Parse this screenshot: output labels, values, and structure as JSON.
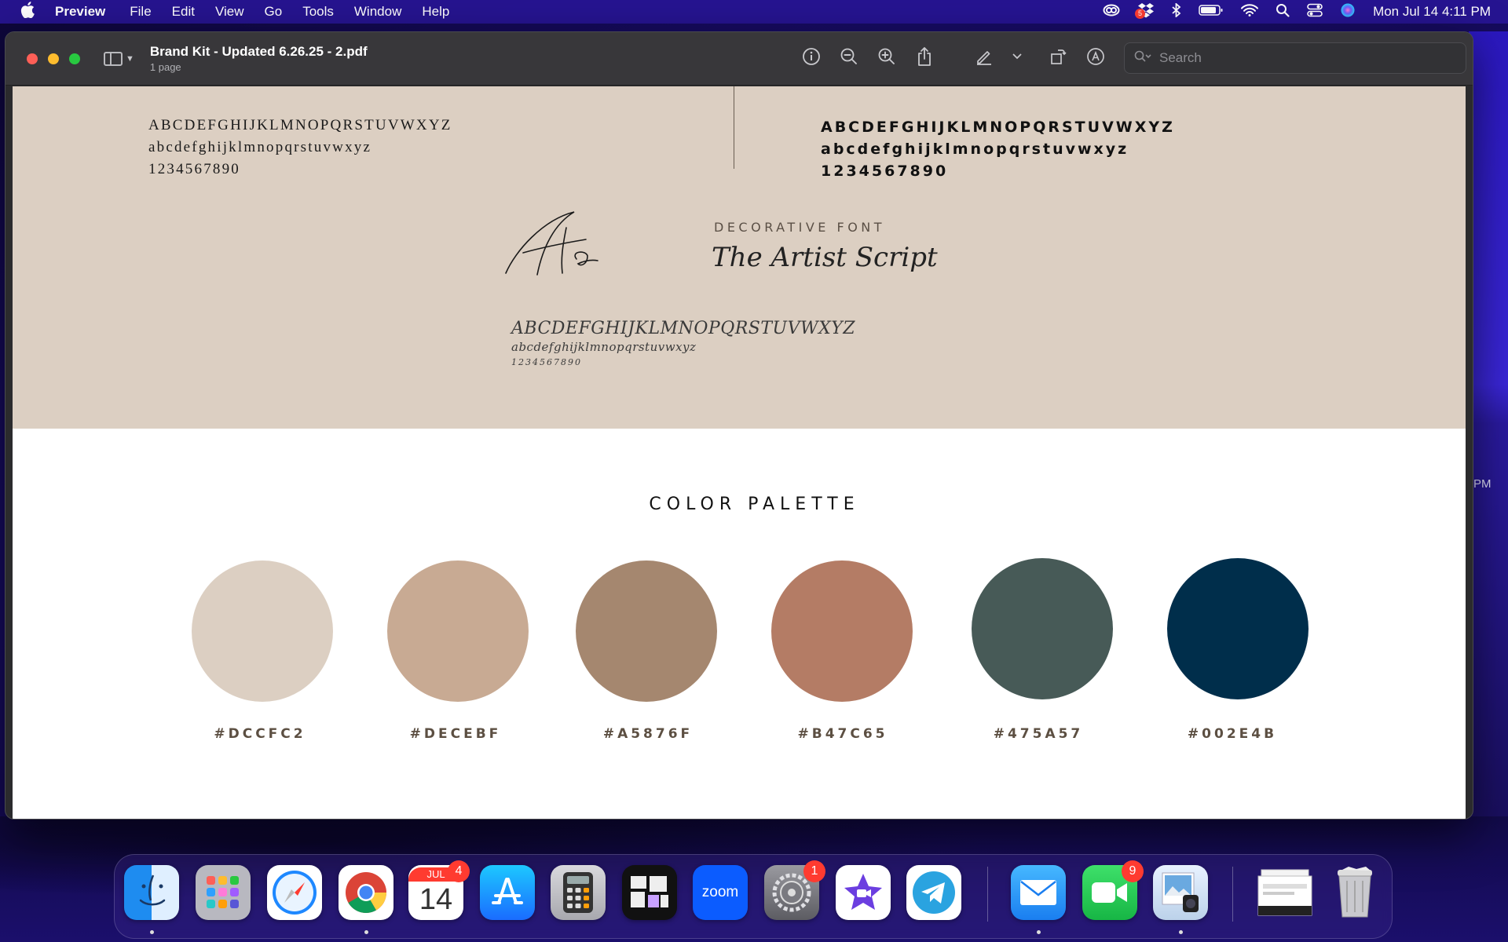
{
  "menubar": {
    "app_name": "Preview",
    "items": [
      "File",
      "Edit",
      "View",
      "Go",
      "Tools",
      "Window",
      "Help"
    ],
    "clock": "Mon Jul 14  4:11 PM",
    "status_icons": [
      "creative-cloud-icon",
      "dropbox-icon",
      "bluetooth-icon",
      "battery-icon",
      "wifi-icon",
      "spotlight-icon",
      "control-center-icon",
      "siri-icon"
    ],
    "dropbox_badge": "5"
  },
  "window": {
    "title": "Brand Kit - Updated 6.26.25 - 2.pdf",
    "subtitle": "1 page",
    "search_placeholder": "Search"
  },
  "document": {
    "serif_alphabet": {
      "upper": "ABCDEFGHIJKLMNOPQRSTUVWXYZ",
      "lower": "abcdefghijklmnopqrstuvwxyz",
      "digits": "1234567890"
    },
    "sans_alphabet": {
      "upper": "ABCDEFGHIJKLMNOPQRSTUVWXYZ",
      "lower": "abcdefghijklmnopqrstuvwxyz",
      "digits": "1234567890"
    },
    "script_glyph": "Aa",
    "decorative_label": "DECORATIVE FONT",
    "decorative_name": "The Artist Script",
    "script_alphabet": {
      "upper": "ABCDEFGHIJKLMNOPQRSTUVWXYZ",
      "lower": "abcdefghijklmnopqrstuvwxyz",
      "digits": "1234567890"
    },
    "palette_title": "COLOR PALETTE",
    "palette": [
      {
        "label": "#DCCFC2",
        "color": "#DCCFC2"
      },
      {
        "label": "#DECEBF",
        "color": "#C8AA93"
      },
      {
        "label": "#A5876F",
        "color": "#A5876F"
      },
      {
        "label": "#B47C65",
        "color": "#B47C65"
      },
      {
        "label": "#475A57",
        "color": "#475A57"
      },
      {
        "label": "#002E4B",
        "color": "#002E4B"
      }
    ]
  },
  "dock": {
    "apps": [
      {
        "name": "finder"
      },
      {
        "name": "launchpad"
      },
      {
        "name": "safari"
      },
      {
        "name": "chrome"
      },
      {
        "name": "calendar",
        "month": "JUL",
        "day": "14",
        "badge": "4"
      },
      {
        "name": "app-store"
      },
      {
        "name": "calculator"
      },
      {
        "name": "mission-control"
      },
      {
        "name": "zoom",
        "label": "zoom"
      },
      {
        "name": "system-settings",
        "badge": "1"
      },
      {
        "name": "imovie"
      },
      {
        "name": "telegram"
      },
      {
        "name": "mail"
      },
      {
        "name": "facetime",
        "badge": "9"
      },
      {
        "name": "preview"
      },
      {
        "name": "downloads-stack"
      },
      {
        "name": "trash"
      }
    ]
  }
}
